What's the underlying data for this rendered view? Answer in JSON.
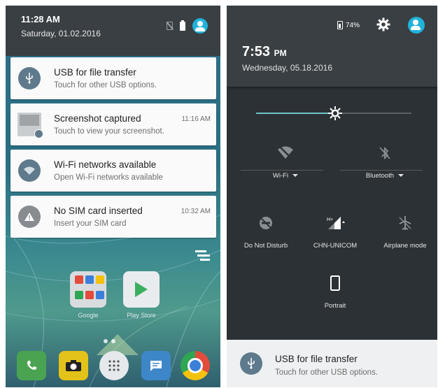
{
  "left_panel": {
    "status": {
      "time": "11:28 AM",
      "date": "Saturday, 01.02.2016",
      "icons": [
        "no-sim-icon",
        "battery-icon",
        "user-avatar-icon"
      ]
    },
    "notifications": [
      {
        "title": "USB for file transfer",
        "subtitle": "Touch for other USB options.",
        "time": "",
        "icon": "usb-icon"
      },
      {
        "title": "Screenshot captured",
        "subtitle": "Touch to view your screenshot.",
        "time": "11:16 AM",
        "icon": "screenshot-thumbnail"
      },
      {
        "title": "Wi-Fi networks available",
        "subtitle": "Open Wi-Fi networks available",
        "time": "",
        "icon": "wifi-icon"
      },
      {
        "title": "No SIM card inserted",
        "subtitle": "Insert your SIM card",
        "time": "10:32 AM",
        "icon": "warning-icon"
      }
    ],
    "clear_all_icon": "clear-all-icon",
    "home_apps": [
      {
        "label": "Google",
        "icon": "google-folder-icon"
      },
      {
        "label": "Play Store",
        "icon": "play-store-icon"
      }
    ],
    "dock": [
      {
        "icon": "phone-icon"
      },
      {
        "icon": "camera-icon"
      },
      {
        "icon": "app-drawer-icon"
      },
      {
        "icon": "messaging-icon"
      },
      {
        "icon": "chrome-icon"
      }
    ],
    "colors": {
      "header": "#3a3f44",
      "accent": "#20b3d9",
      "notif_icon": "#5e7a8c"
    }
  },
  "right_panel": {
    "status": {
      "battery": "74%",
      "time": "7:53",
      "time_suffix": "PM",
      "date": "Wednesday, 05.18.2016",
      "icons": [
        "battery-icon",
        "settings-gear-icon",
        "user-avatar-icon"
      ]
    },
    "brightness_level": 0.51,
    "quick_settings": [
      {
        "label": "Wi-Fi",
        "icon": "wifi-off-icon",
        "has_dropdown": true
      },
      {
        "label": "Bluetooth",
        "icon": "bluetooth-off-icon",
        "has_dropdown": true
      },
      {
        "label": "Do Not Disturb",
        "icon": "do-not-disturb-icon",
        "has_dropdown": false
      },
      {
        "label": "CHN-UNICOM",
        "icon": "cellular-signal-icon",
        "has_dropdown": false
      },
      {
        "label": "Airplane mode",
        "icon": "airplane-mode-icon",
        "has_dropdown": false
      },
      {
        "label": "Portrait",
        "icon": "portrait-rotation-icon",
        "has_dropdown": false
      }
    ],
    "notification": {
      "title": "USB for file transfer",
      "subtitle": "Touch for other USB options.",
      "icon": "usb-icon"
    },
    "colors": {
      "panel_bg": "#2c3135",
      "header": "#3a3f43",
      "brightness_fill": "#6fc4c7",
      "accent": "#20b3d9"
    }
  }
}
